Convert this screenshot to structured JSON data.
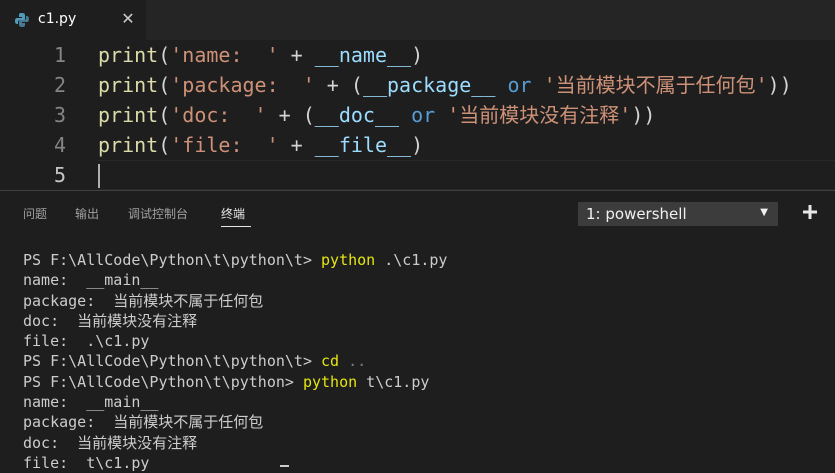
{
  "tab": {
    "title": "c1.py",
    "close": "✕",
    "icon": "python-icon"
  },
  "editor": {
    "lines": [
      {
        "num": "1",
        "segments": [
          {
            "t": "print",
            "c": "fn"
          },
          {
            "t": "(",
            "c": "op"
          },
          {
            "t": "'name:  '",
            "c": "str"
          },
          {
            "t": " + ",
            "c": "op"
          },
          {
            "t": "__name__",
            "c": "var"
          },
          {
            "t": ")",
            "c": "op"
          }
        ]
      },
      {
        "num": "2",
        "segments": [
          {
            "t": "print",
            "c": "fn"
          },
          {
            "t": "(",
            "c": "op"
          },
          {
            "t": "'package:  '",
            "c": "str"
          },
          {
            "t": " + (",
            "c": "op"
          },
          {
            "t": "__package__",
            "c": "var"
          },
          {
            "t": " ",
            "c": "op"
          },
          {
            "t": "or",
            "c": "kw"
          },
          {
            "t": " ",
            "c": "op"
          },
          {
            "t": "'当前模块不属于任何包'",
            "c": "str"
          },
          {
            "t": "))",
            "c": "op"
          }
        ]
      },
      {
        "num": "3",
        "segments": [
          {
            "t": "print",
            "c": "fn"
          },
          {
            "t": "(",
            "c": "op"
          },
          {
            "t": "'doc:  '",
            "c": "str"
          },
          {
            "t": " + (",
            "c": "op"
          },
          {
            "t": "__doc__",
            "c": "var"
          },
          {
            "t": " ",
            "c": "op"
          },
          {
            "t": "or",
            "c": "kw"
          },
          {
            "t": " ",
            "c": "op"
          },
          {
            "t": "'当前模块没有注释'",
            "c": "str"
          },
          {
            "t": "))",
            "c": "op"
          }
        ]
      },
      {
        "num": "4",
        "segments": [
          {
            "t": "print",
            "c": "fn"
          },
          {
            "t": "(",
            "c": "op"
          },
          {
            "t": "'file:  '",
            "c": "str"
          },
          {
            "t": " + ",
            "c": "op"
          },
          {
            "t": "__file__",
            "c": "var"
          },
          {
            "t": ")",
            "c": "op"
          }
        ]
      },
      {
        "num": "5",
        "segments": []
      }
    ]
  },
  "panel": {
    "tabs": [
      "问题",
      "输出",
      "调试控制台",
      "终端"
    ],
    "active_tab": "终端",
    "terminal_select": "1: powershell",
    "add_label": "+"
  },
  "terminal": {
    "lines": [
      {
        "prompt": "PS F:\\AllCode\\Python\\t\\python\\t> ",
        "cmd": "python",
        "args": " .\\c1.py"
      },
      {
        "text": "name:  __main__"
      },
      {
        "text": "package:  当前模块不属于任何包"
      },
      {
        "text": "doc:  当前模块没有注释"
      },
      {
        "text": "file:  .\\c1.py"
      },
      {
        "prompt": "PS F:\\AllCode\\Python\\t\\python\\t> ",
        "cmd": "cd",
        "args": " ..",
        "dim_args": true
      },
      {
        "prompt": "PS F:\\AllCode\\Python\\t\\python> ",
        "cmd": "python",
        "args": " t\\c1.py"
      },
      {
        "text": "name:  __main__"
      },
      {
        "text": "package:  当前模块不属于任何包"
      },
      {
        "text": "doc:  当前模块没有注释"
      },
      {
        "text": "file:  t\\c1.py"
      }
    ]
  },
  "colors": {
    "background": "#1e1e1e",
    "function": "#dcdcaa",
    "string": "#ce9178",
    "variable": "#9cdcfe",
    "keyword": "#569cd6",
    "terminal_command": "#e5e510"
  }
}
